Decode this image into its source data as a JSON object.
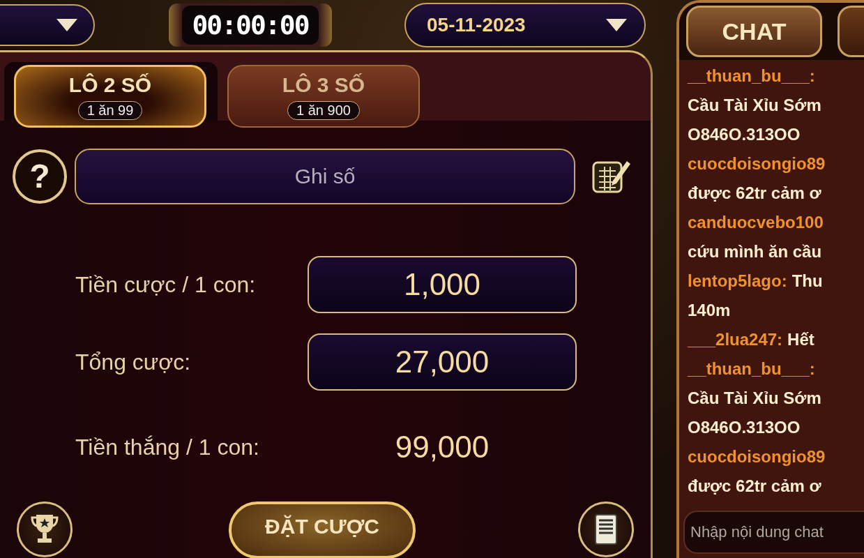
{
  "top_bar": {
    "timer": "00:00:00",
    "date": "05-11-2023"
  },
  "tabs": [
    {
      "label": "LÔ 2 SỐ",
      "odds": "1 ăn 99",
      "selected": true
    },
    {
      "label": "LÔ 3 SỐ",
      "odds": "1 ăn 900",
      "selected": false
    }
  ],
  "help_button": "?",
  "number_field": {
    "placeholder": "Ghi số"
  },
  "bet_rows": [
    {
      "kind": "field",
      "label": "Tiền cược / 1 con:",
      "value": "1,000"
    },
    {
      "kind": "field",
      "label": "Tổng cược:",
      "value": "27,000"
    },
    {
      "kind": "text",
      "label": "Tiền thắng / 1 con:",
      "value": "99,000"
    }
  ],
  "place_bet_button": "ĐẶT CƯỢC",
  "chat": {
    "tabs": [
      {
        "label": "CHAT",
        "selected": true
      },
      {
        "selected": false
      }
    ],
    "lines": [
      {
        "user": "__thuan_bu___:"
      },
      {
        "text": "Cầu Tài Xỉu Sớm"
      },
      {
        "text": "O846O.313OO"
      },
      {
        "user": "cuocdoisongio89"
      },
      {
        "text": "được 62tr cảm ơ"
      },
      {
        "user": "canduocvebo100"
      },
      {
        "text": "cứu mình ăn cầu"
      },
      {
        "user": "lentop5lago:",
        "text": "Thu"
      },
      {
        "text": "140m"
      },
      {
        "user": "___2lua247:",
        "text": "Hết"
      },
      {
        "user": "__thuan_bu___:"
      },
      {
        "text": "Cầu Tài Xỉu Sớm"
      },
      {
        "text": "O846O.313OO"
      },
      {
        "user": "cuocdoisongio89"
      },
      {
        "text": "được 62tr cảm ơ"
      }
    ],
    "input": {
      "placeholder": "Nhập nội dung chat"
    }
  }
}
